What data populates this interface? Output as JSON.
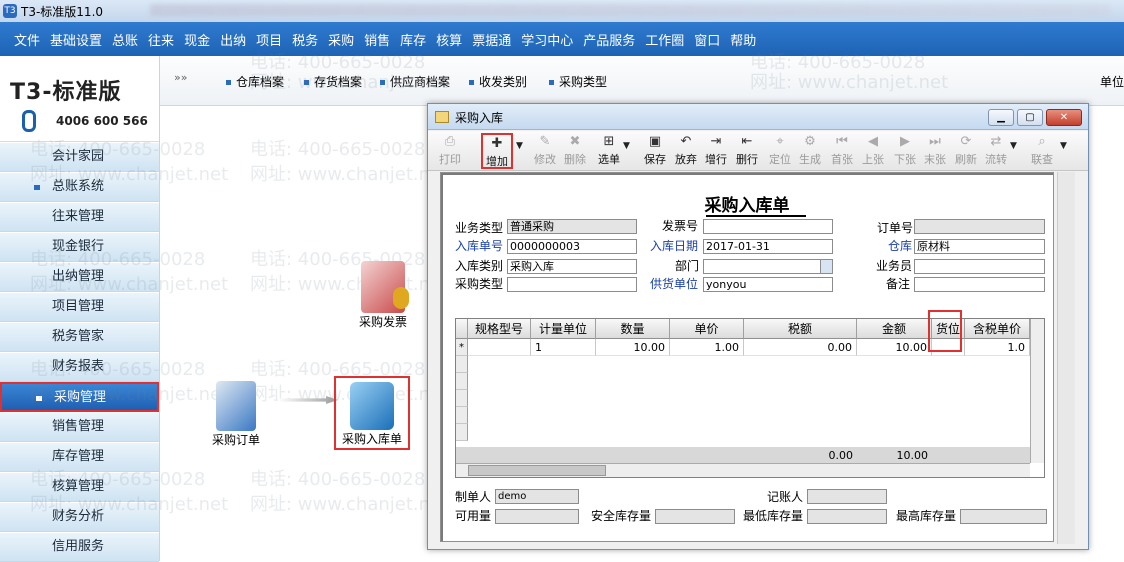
{
  "app_title": "T3-标准版11.0",
  "menu": [
    "文件",
    "基础设置",
    "总账",
    "往来",
    "现金",
    "出纳",
    "项目",
    "税务",
    "采购",
    "销售",
    "库存",
    "核算",
    "票据通",
    "学习中心",
    "产品服务",
    "工作圈",
    "窗口",
    "帮助"
  ],
  "subnav": {
    "items": [
      "仓库档案",
      "存货档案",
      "供应商档案",
      "收发类别",
      "采购类型"
    ],
    "right_label": "单位"
  },
  "logo": {
    "brand": "T3-标准版",
    "phone": "4006 600 566"
  },
  "sidebar": [
    {
      "label": "会计家园",
      "bullet": false,
      "active": false
    },
    {
      "label": "总账系统",
      "bullet": true,
      "active": false
    },
    {
      "label": "往来管理",
      "bullet": false,
      "active": false
    },
    {
      "label": "现金银行",
      "bullet": false,
      "active": false
    },
    {
      "label": "出纳管理",
      "bullet": false,
      "active": false
    },
    {
      "label": "项目管理",
      "bullet": false,
      "active": false
    },
    {
      "label": "税务管家",
      "bullet": false,
      "active": false
    },
    {
      "label": "财务报表",
      "bullet": false,
      "active": false
    },
    {
      "label": "采购管理",
      "bullet": true,
      "active": true
    },
    {
      "label": "销售管理",
      "bullet": false,
      "active": false
    },
    {
      "label": "库存管理",
      "bullet": false,
      "active": false
    },
    {
      "label": "核算管理",
      "bullet": false,
      "active": false
    },
    {
      "label": "财务分析",
      "bullet": false,
      "active": false
    },
    {
      "label": "信用服务",
      "bullet": false,
      "active": false
    }
  ],
  "flow": {
    "invoice": "采购发票",
    "order": "采购订单",
    "receipt": "采购入库单"
  },
  "watermark": {
    "phone": "电话: 400-665-0028",
    "site": "网址: www.chanjet.net"
  },
  "window": {
    "title": "采购入库",
    "toolbar": [
      {
        "label": "打印",
        "icon": "⎙",
        "disabled": true
      },
      {
        "label": "增加",
        "icon": "✚",
        "disabled": false,
        "highlighted": true
      },
      {
        "label": "修改",
        "icon": "✎",
        "disabled": true
      },
      {
        "label": "删除",
        "icon": "✖",
        "disabled": true
      },
      {
        "label": "选单",
        "icon": "⊞",
        "disabled": false
      },
      {
        "label": "保存",
        "icon": "▣",
        "disabled": false
      },
      {
        "label": "放弃",
        "icon": "↶",
        "disabled": false
      },
      {
        "label": "增行",
        "icon": "⇥",
        "disabled": false
      },
      {
        "label": "删行",
        "icon": "⇤",
        "disabled": false
      },
      {
        "label": "定位",
        "icon": "⌖",
        "disabled": true
      },
      {
        "label": "生成",
        "icon": "⚙",
        "disabled": true
      },
      {
        "label": "首张",
        "icon": "⏮",
        "disabled": true
      },
      {
        "label": "上张",
        "icon": "◀",
        "disabled": true
      },
      {
        "label": "下张",
        "icon": "▶",
        "disabled": true
      },
      {
        "label": "末张",
        "icon": "⏭",
        "disabled": true
      },
      {
        "label": "刷新",
        "icon": "⟳",
        "disabled": true
      },
      {
        "label": "流转",
        "icon": "⇄",
        "disabled": true
      },
      {
        "label": "联查",
        "icon": "⌕",
        "disabled": true
      }
    ],
    "doc_title": "采购入库单",
    "header": {
      "biz_type": {
        "label": "业务类型",
        "value": "普通采购"
      },
      "invoice_no": {
        "label": "发票号",
        "value": ""
      },
      "order_no": {
        "label": "订单号",
        "value": ""
      },
      "in_no": {
        "label": "入库单号",
        "value": "0000000003"
      },
      "in_date": {
        "label": "入库日期",
        "value": "2017-01-31"
      },
      "warehouse": {
        "label": "仓库",
        "value": "原材料"
      },
      "in_type": {
        "label": "入库类别",
        "value": "采购入库"
      },
      "dept": {
        "label": "部门",
        "value": ""
      },
      "clerk": {
        "label": "业务员",
        "value": ""
      },
      "purchase_type": {
        "label": "采购类型",
        "value": ""
      },
      "supplier": {
        "label": "供货单位",
        "value": "yonyou"
      },
      "note": {
        "label": "备注",
        "value": ""
      }
    },
    "grid": {
      "columns": [
        "规格型号",
        "计量单位",
        "数量",
        "单价",
        "税额",
        "金额",
        "货位",
        "含税单价"
      ],
      "row_marker": "*",
      "row": [
        "",
        "1",
        "10.00",
        "1.00",
        "0.00",
        "10.00",
        "",
        "1.0"
      ],
      "totals": {
        "tax": "0.00",
        "amount": "10.00"
      }
    },
    "footer": {
      "maker": {
        "label": "制单人",
        "value": "demo"
      },
      "accountant": {
        "label": "记账人",
        "value": ""
      },
      "available": {
        "label": "可用量",
        "value": ""
      },
      "safety": {
        "label": "安全库存量",
        "value": ""
      },
      "min": {
        "label": "最低库存量",
        "value": ""
      },
      "max": {
        "label": "最高库存量",
        "value": ""
      }
    }
  },
  "colors": {
    "menubar": "#1e63b4",
    "highlight": "#e03030",
    "active_item": "#1f5fb0"
  }
}
